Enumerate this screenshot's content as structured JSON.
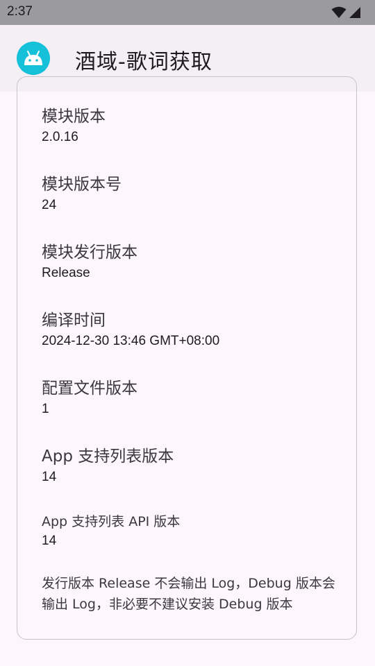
{
  "status_bar": {
    "time": "2:37",
    "icons": [
      "wifi-icon",
      "cellular-signal-icon"
    ]
  },
  "app_bar": {
    "icon": "android-icon",
    "title": "酒域-歌词获取"
  },
  "info": {
    "module_version": {
      "label": "模块版本",
      "value": "2.0.16"
    },
    "module_version_code": {
      "label": "模块版本号",
      "value": "24"
    },
    "release_type": {
      "label": "模块发行版本",
      "value": "Release"
    },
    "build_time": {
      "label": "编译时间",
      "value": "2024-12-30 13:46 GMT+08:00"
    },
    "config_version": {
      "label": "配置文件版本",
      "value": "1"
    },
    "app_support_list_version": {
      "label": "App 支持列表版本",
      "value": "14"
    },
    "app_support_list_api_version": {
      "label": "App 支持列表 API 版本",
      "value": "14"
    }
  },
  "note": "发行版本 Release 不会输出 Log，Debug 版本会输出 Log，非必要不建议安装 Debug 版本",
  "colors": {
    "status_bar_bg": "#9b9a9f",
    "app_bar_bg": "#f4eef5",
    "page_bg": "#fdf7fd",
    "logo_bg": "#15c1d8",
    "card_border": "#c7c3cb"
  }
}
